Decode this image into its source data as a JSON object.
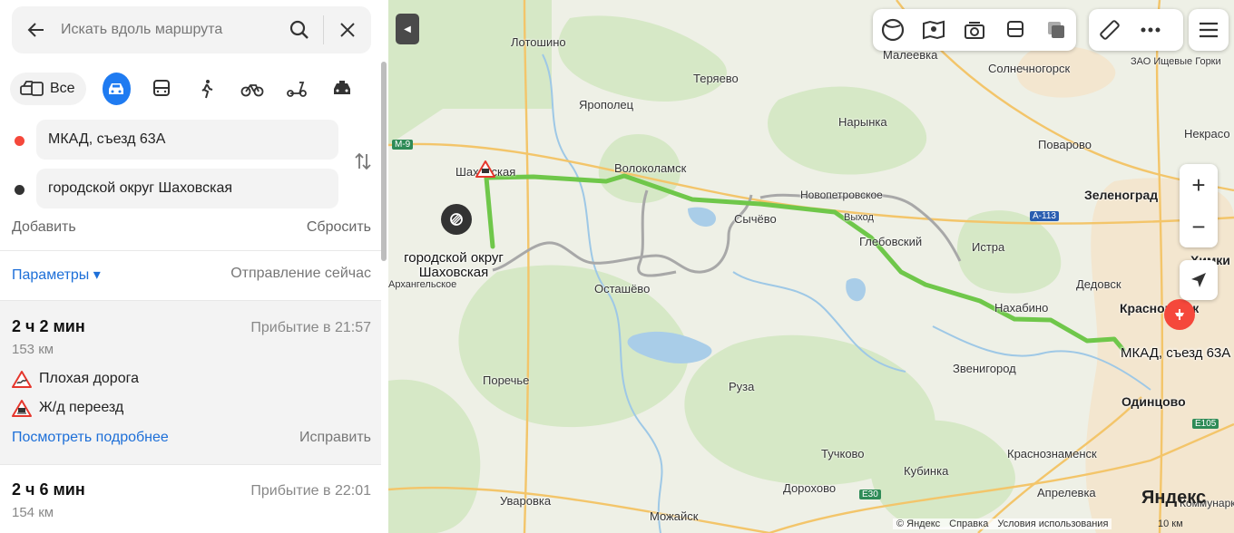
{
  "search": {
    "placeholder": "Искать вдоль маршрута"
  },
  "modes": {
    "all_label": "Все"
  },
  "points": {
    "from": "МКАД, съезд 63А",
    "to": "городской округ Шаховская",
    "from_color": "#f5483b",
    "to_color": "#333333"
  },
  "actions": {
    "add": "Добавить",
    "reset": "Сбросить"
  },
  "params": {
    "label": "Параметры ▾",
    "departure": "Отправление сейчас"
  },
  "routes": [
    {
      "duration": "2 ч 2 мин",
      "arrival": "Прибытие в 21:57",
      "distance": "153 км",
      "warnings": [
        "Плохая дорога",
        "Ж/д переезд"
      ],
      "details_link": "Посмотреть подробнее",
      "fix_link": "Исправить"
    },
    {
      "duration": "2 ч 6 мин",
      "arrival": "Прибытие в 22:01",
      "distance": "154 км"
    }
  ],
  "map": {
    "route_color": "#6fc74a",
    "alt_route_color": "#a8a8a8",
    "start_label": "городской округ Шаховская",
    "end_label": "МКАД, съезд 63А",
    "places": [
      {
        "name": "Лотошино"
      },
      {
        "name": "Теряево"
      },
      {
        "name": "Малеевка"
      },
      {
        "name": "Солнечногорск"
      },
      {
        "name": "Горки"
      },
      {
        "name": "Ярополец"
      },
      {
        "name": "Нарынка"
      },
      {
        "name": "Поварово"
      },
      {
        "name": "Некрасо"
      },
      {
        "name": "Шаховская"
      },
      {
        "name": "Волоколамск"
      },
      {
        "name": "Новопетровское"
      },
      {
        "name": "Зеленоград"
      },
      {
        "name": "Сычёво"
      },
      {
        "name": "Выход"
      },
      {
        "name": "Глебовский"
      },
      {
        "name": "Истра"
      },
      {
        "name": "Химки"
      },
      {
        "name": "Архангельское"
      },
      {
        "name": "Осташёво"
      },
      {
        "name": "Дедовск"
      },
      {
        "name": "Нахабино"
      },
      {
        "name": "Красногорск"
      },
      {
        "name": "Руза"
      },
      {
        "name": "Звенигород"
      },
      {
        "name": "Поречье"
      },
      {
        "name": "Одинцово"
      },
      {
        "name": "Тучково"
      },
      {
        "name": "Краснознаменск"
      },
      {
        "name": "Кубинка"
      },
      {
        "name": "Дорохово"
      },
      {
        "name": "Апрелевка"
      },
      {
        "name": "Уваровка"
      },
      {
        "name": "Можайск"
      },
      {
        "name": "Коммунарка"
      },
      {
        "name": "ЗАО Ищевые Горки"
      }
    ],
    "shields": [
      "M-9",
      "A-113",
      "E30",
      "E105"
    ],
    "brand": "Яндекс",
    "footer": [
      "© Яндекс",
      "Справка",
      "Условия использования"
    ],
    "scale": "10 км"
  }
}
